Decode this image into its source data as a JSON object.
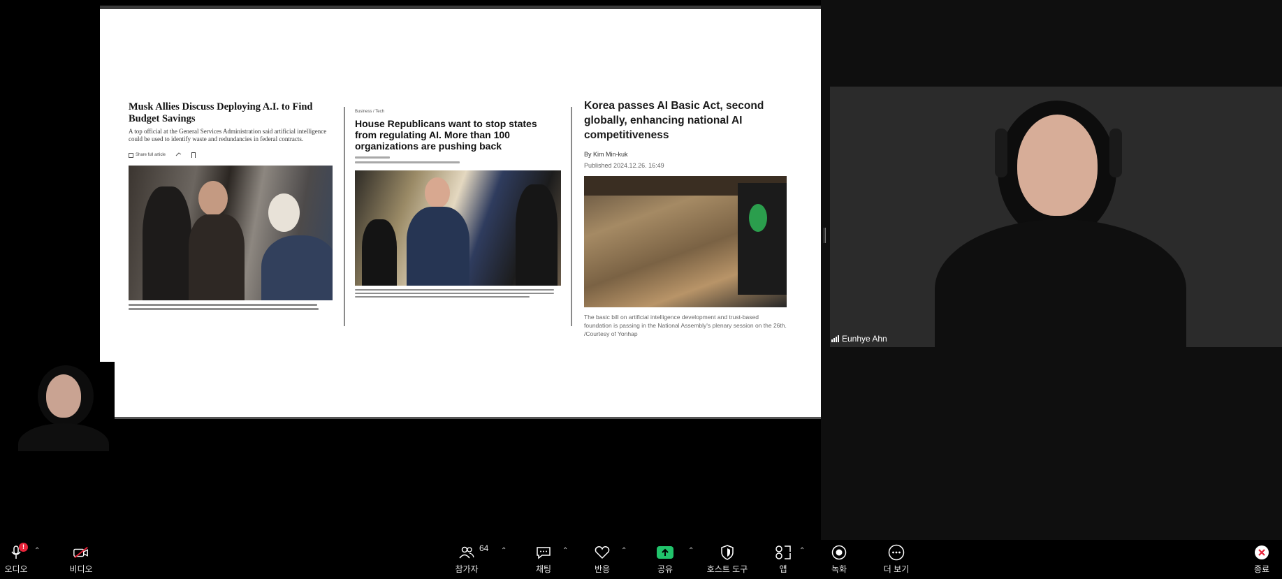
{
  "slide": {
    "article1": {
      "headline": "Musk Allies Discuss Deploying A.I. to Find Budget Savings",
      "summary": "A top official at the General Services Administration said artificial intelligence could be used to identify waste and redundancies in federal contracts.",
      "share_label": "Share full article"
    },
    "article2": {
      "kicker": "Business / Tech",
      "headline": "House Republicans want to stop states from regulating AI. More than 100 organizations are pushing back"
    },
    "article3": {
      "headline": "Korea passes AI Basic Act, second globally, enhancing national AI competitiveness",
      "byline": "By Kim Min-kuk",
      "published": "Published 2024.12.26. 16:49",
      "caption": "The basic bill on artificial intelligence development and trust-based foundation is passing in the National Assembly's plenary session on the 26th. /Courtesy of Yonhap"
    }
  },
  "speaker": {
    "name": "Eunhye Ahn"
  },
  "toolbar": {
    "audio": "오디오",
    "audio_badge": "!",
    "video": "비디오",
    "participants": "참가자",
    "participants_count": "64",
    "chat": "채팅",
    "reactions": "반응",
    "share": "공유",
    "host_tools": "호스트 도구",
    "apps": "앱",
    "record": "녹화",
    "more": "더 보기",
    "end": "종료"
  },
  "colors": {
    "share_green": "#21c36b",
    "alert_red": "#e8243a",
    "background": "#000000"
  }
}
